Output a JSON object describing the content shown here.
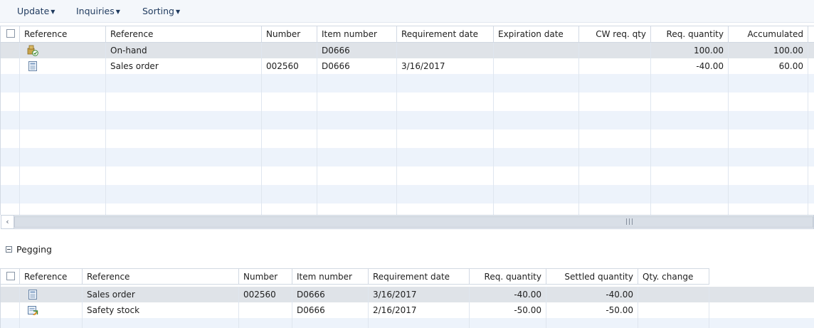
{
  "toolbar": {
    "update": "Update",
    "inquiries": "Inquiries",
    "sorting": "Sorting"
  },
  "top_grid": {
    "columns": [
      "Reference",
      "Reference",
      "Number",
      "Item number",
      "Requirement date",
      "Expiration date",
      "CW req. qty",
      "Req. quantity",
      "Accumulated"
    ],
    "rows": [
      {
        "icon": "on-hand-icon",
        "reference": "On-hand",
        "number": "",
        "item": "D0666",
        "req_date": "",
        "exp_date": "",
        "cw_qty": "",
        "req_qty": "100.00",
        "accumulated": "100.00"
      },
      {
        "icon": "sales-order-icon",
        "reference": "Sales order",
        "number": "002560",
        "item": "D0666",
        "req_date": "3/16/2017",
        "exp_date": "",
        "cw_qty": "",
        "req_qty": "-40.00",
        "accumulated": "60.00"
      }
    ]
  },
  "pegging": {
    "title": "Pegging",
    "columns": [
      "Reference",
      "Reference",
      "Number",
      "Item number",
      "Requirement date",
      "Req. quantity",
      "Settled quantity",
      "Qty. change"
    ],
    "rows": [
      {
        "icon": "sales-order-icon",
        "reference": "Sales order",
        "number": "002560",
        "item": "D0666",
        "req_date": "3/16/2017",
        "req_qty": "-40.00",
        "settled": "-40.00",
        "qty_change": ""
      },
      {
        "icon": "safety-stock-icon",
        "reference": "Safety stock",
        "number": "",
        "item": "D0666",
        "req_date": "2/16/2017",
        "req_qty": "-50.00",
        "settled": "-50.00",
        "qty_change": ""
      }
    ]
  },
  "colors": {
    "toolbar_text": "#1f3a5e",
    "alt_row": "#edf3fb",
    "selected_row": "#dfe3e8"
  }
}
